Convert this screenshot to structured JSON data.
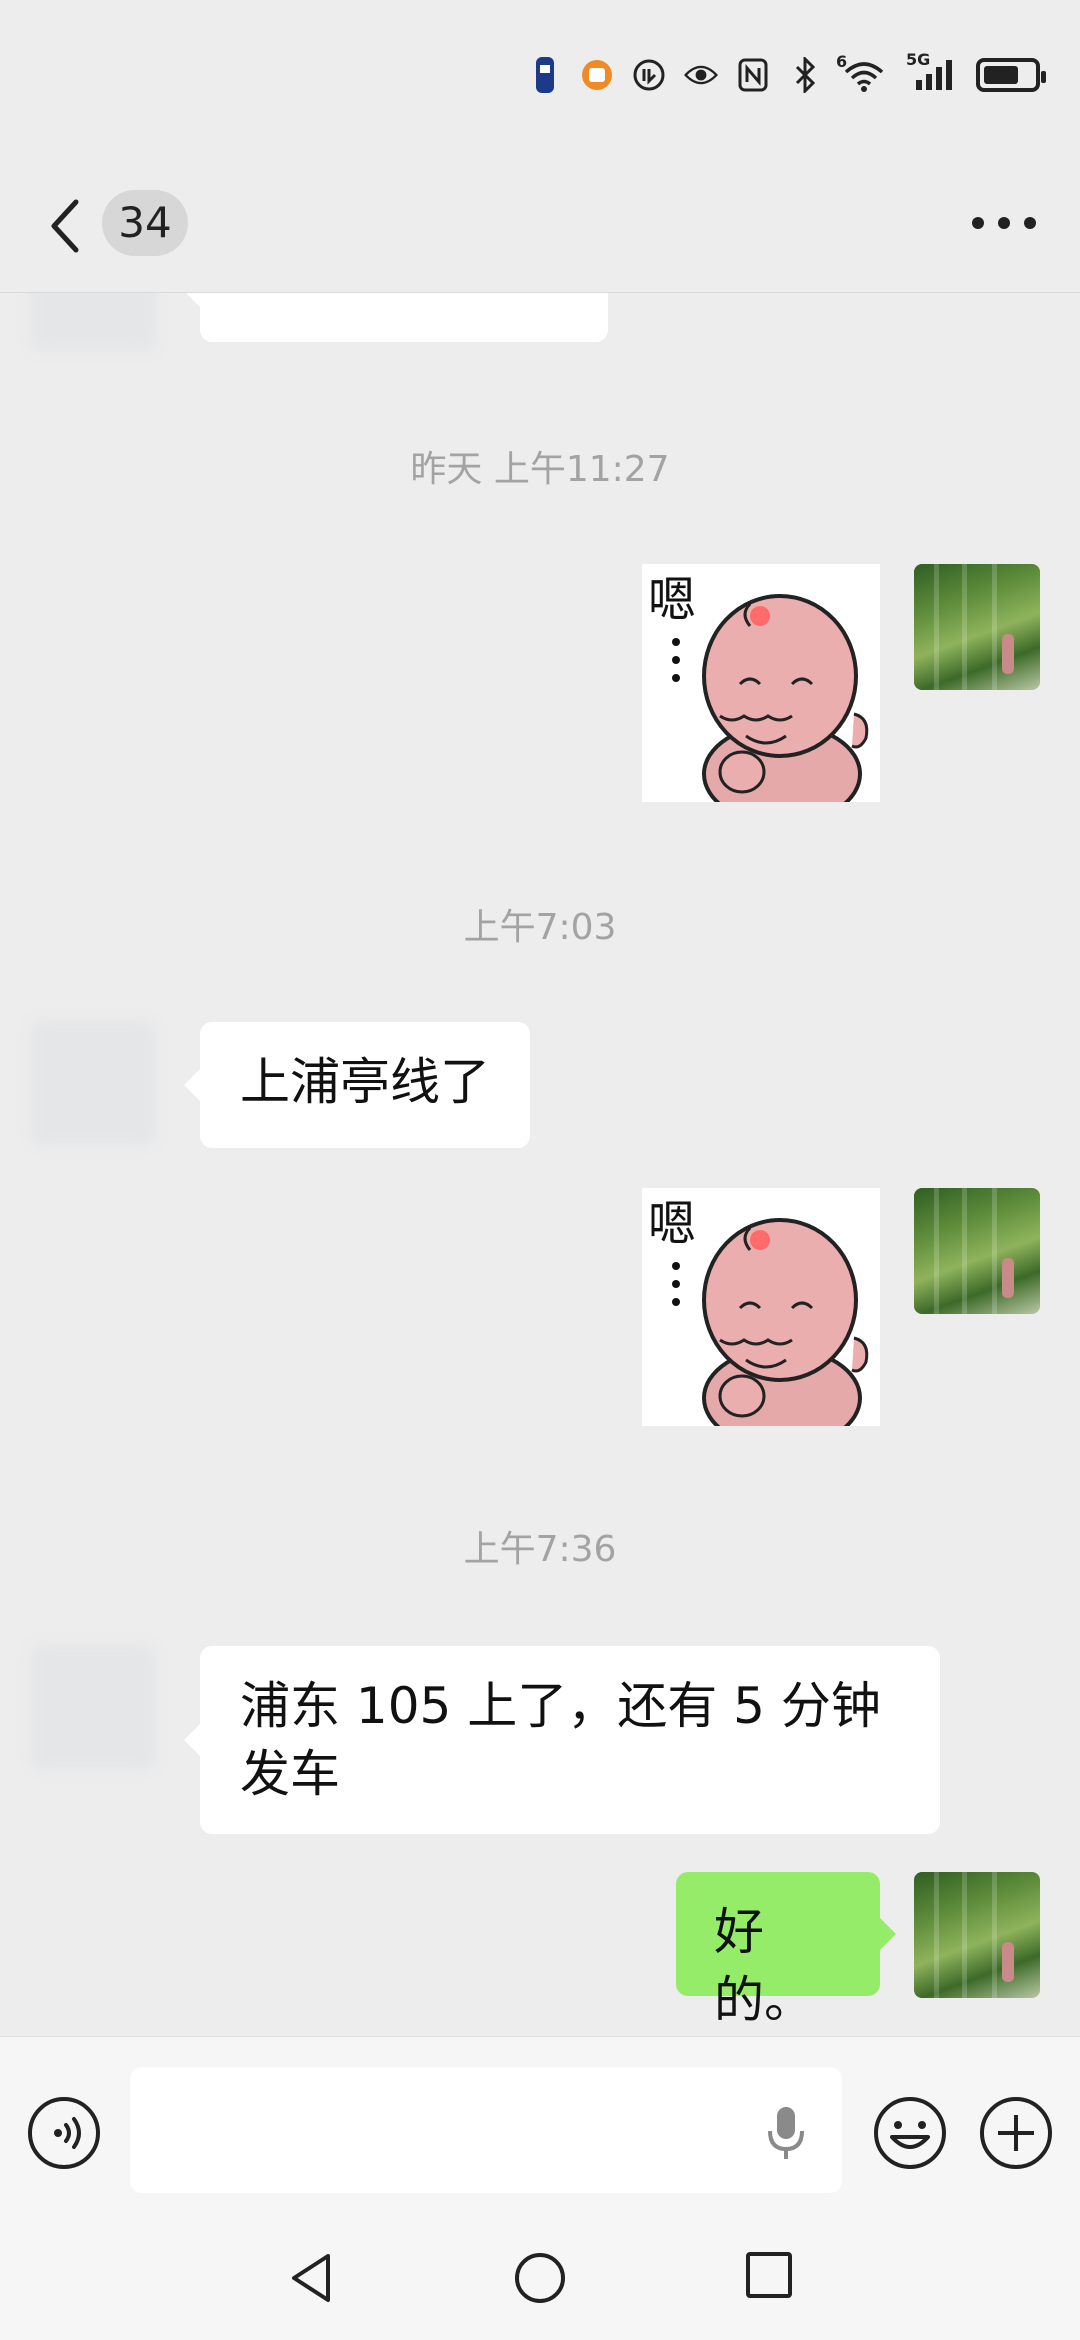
{
  "status_bar": {
    "icons": [
      "notification-app-icon-1",
      "notification-app-icon-2",
      "nfc-indicator-icon",
      "eye-icon",
      "nfc-icon",
      "bluetooth-icon",
      "wifi-icon",
      "5g-signal-icon",
      "battery-icon"
    ],
    "wifi_badge": "6",
    "network_label": "5G",
    "battery_level": 0.7
  },
  "header": {
    "unread_count": "34"
  },
  "messages": [
    {
      "type": "timestamp",
      "text": "昨天 上午11:27"
    },
    {
      "type": "sticker",
      "side": "right",
      "sticker_text": "嗯"
    },
    {
      "type": "timestamp",
      "text": "上午7:03"
    },
    {
      "type": "text",
      "side": "left",
      "text": "上浦亭线了"
    },
    {
      "type": "sticker",
      "side": "right",
      "sticker_text": "嗯"
    },
    {
      "type": "timestamp",
      "text": "上午7:36"
    },
    {
      "type": "text",
      "side": "left",
      "text": "浦东 105 上了，还有 5 分钟发车"
    },
    {
      "type": "text",
      "side": "right",
      "text": "好的。"
    }
  ],
  "input": {
    "placeholder": "",
    "value": ""
  },
  "colors": {
    "background": "#ededed",
    "sent_bubble": "#95ec69",
    "received_bubble": "#ffffff",
    "timestamp_text": "#a3a3a3"
  }
}
